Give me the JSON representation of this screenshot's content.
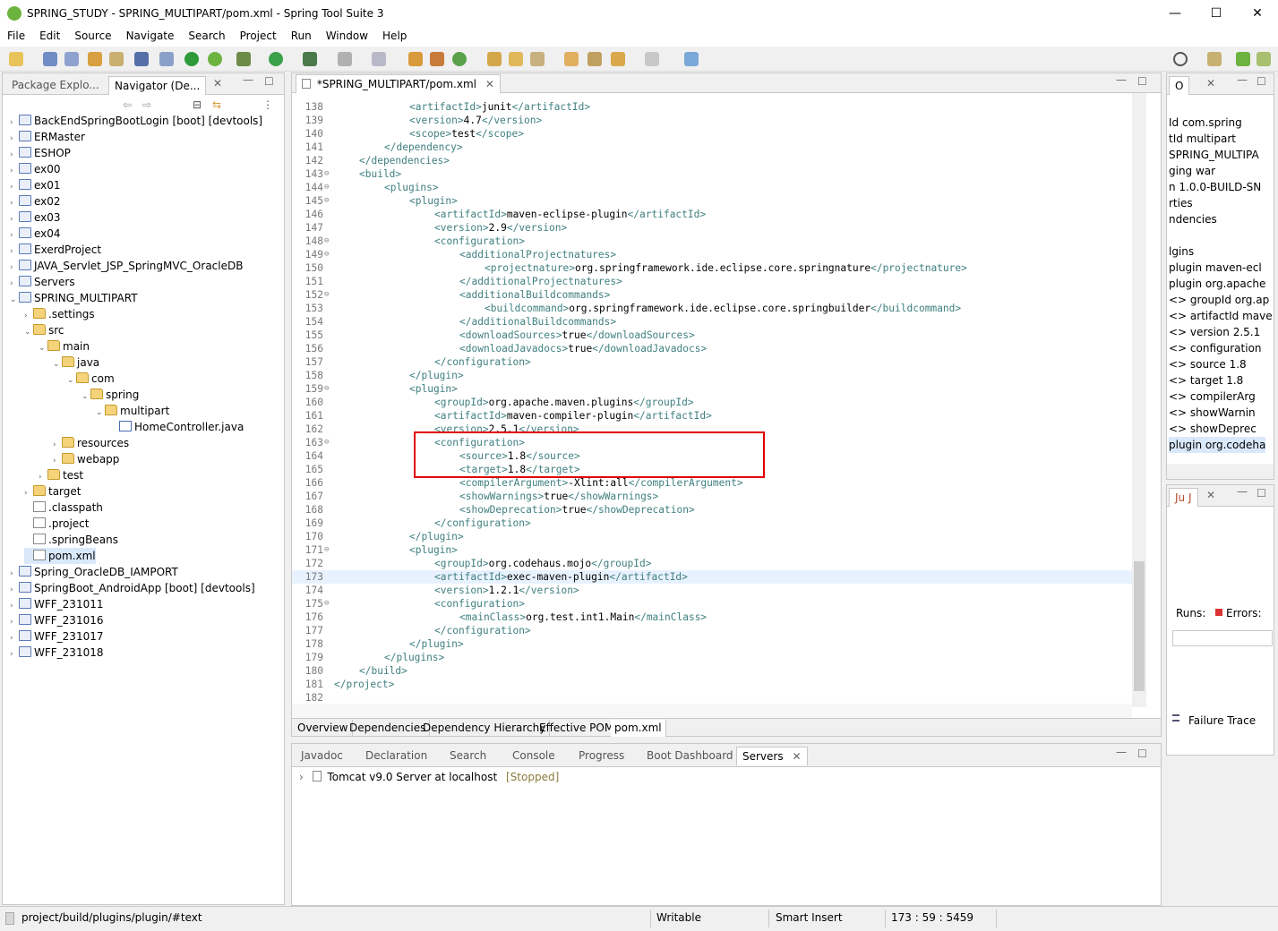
{
  "window": {
    "title": "SPRING_STUDY - SPRING_MULTIPART/pom.xml - Spring Tool Suite 3",
    "minimize": "—",
    "maximize": "☐",
    "close": "✕"
  },
  "menu": [
    "File",
    "Edit",
    "Source",
    "Navigate",
    "Search",
    "Project",
    "Run",
    "Window",
    "Help"
  ],
  "left": {
    "tabs": [
      "Package Explo...",
      "Navigator (De..."
    ],
    "tree": [
      {
        "label": "BackEndSpringBootLogin [boot] [devtools]",
        "depth": 0,
        "tw": "›",
        "icon": "proj"
      },
      {
        "label": "ERMaster",
        "depth": 0,
        "tw": "›",
        "icon": "proj"
      },
      {
        "label": "ESHOP",
        "depth": 0,
        "tw": "›",
        "icon": "proj"
      },
      {
        "label": "ex00",
        "depth": 0,
        "tw": "›",
        "icon": "proj"
      },
      {
        "label": "ex01",
        "depth": 0,
        "tw": "›",
        "icon": "proj"
      },
      {
        "label": "ex02",
        "depth": 0,
        "tw": "›",
        "icon": "proj"
      },
      {
        "label": "ex03",
        "depth": 0,
        "tw": "›",
        "icon": "proj"
      },
      {
        "label": "ex04",
        "depth": 0,
        "tw": "›",
        "icon": "proj"
      },
      {
        "label": "ExerdProject",
        "depth": 0,
        "tw": "›",
        "icon": "proj"
      },
      {
        "label": "JAVA_Servlet_JSP_SpringMVC_OracleDB",
        "depth": 0,
        "tw": "›",
        "icon": "proj"
      },
      {
        "label": "Servers",
        "depth": 0,
        "tw": "›",
        "icon": "proj"
      },
      {
        "label": "SPRING_MULTIPART",
        "depth": 0,
        "tw": "⌄",
        "icon": "proj"
      },
      {
        "label": ".settings",
        "depth": 1,
        "tw": "›",
        "icon": "folder"
      },
      {
        "label": "src",
        "depth": 1,
        "tw": "⌄",
        "icon": "folder"
      },
      {
        "label": "main",
        "depth": 2,
        "tw": "⌄",
        "icon": "folder"
      },
      {
        "label": "java",
        "depth": 3,
        "tw": "⌄",
        "icon": "folder"
      },
      {
        "label": "com",
        "depth": 4,
        "tw": "⌄",
        "icon": "folder"
      },
      {
        "label": "spring",
        "depth": 5,
        "tw": "⌄",
        "icon": "folder"
      },
      {
        "label": "multipart",
        "depth": 6,
        "tw": "⌄",
        "icon": "folder"
      },
      {
        "label": "HomeController.java",
        "depth": 7,
        "tw": "",
        "icon": "java"
      },
      {
        "label": "resources",
        "depth": 3,
        "tw": "›",
        "icon": "folder"
      },
      {
        "label": "webapp",
        "depth": 3,
        "tw": "›",
        "icon": "folder"
      },
      {
        "label": "test",
        "depth": 2,
        "tw": "›",
        "icon": "folder"
      },
      {
        "label": "target",
        "depth": 1,
        "tw": "›",
        "icon": "folder"
      },
      {
        "label": ".classpath",
        "depth": 1,
        "tw": "",
        "icon": "file"
      },
      {
        "label": ".project",
        "depth": 1,
        "tw": "",
        "icon": "file"
      },
      {
        "label": ".springBeans",
        "depth": 1,
        "tw": "",
        "icon": "file"
      },
      {
        "label": "pom.xml",
        "depth": 1,
        "tw": "",
        "icon": "file",
        "selected": true
      },
      {
        "label": "Spring_OracleDB_IAMPORT",
        "depth": 0,
        "tw": "›",
        "icon": "proj"
      },
      {
        "label": "SpringBoot_AndroidApp [boot] [devtools]",
        "depth": 0,
        "tw": "›",
        "icon": "proj"
      },
      {
        "label": "WFF_231011",
        "depth": 0,
        "tw": "›",
        "icon": "proj"
      },
      {
        "label": "WFF_231016",
        "depth": 0,
        "tw": "›",
        "icon": "proj"
      },
      {
        "label": "WFF_231017",
        "depth": 0,
        "tw": "›",
        "icon": "proj"
      },
      {
        "label": "WFF_231018",
        "depth": 0,
        "tw": "›",
        "icon": "proj"
      }
    ]
  },
  "editor": {
    "tab": "*SPRING_MULTIPART/pom.xml",
    "lines": [
      {
        "n": "138",
        "indent": 3,
        "segs": [
          [
            "t",
            "<artifactId>"
          ],
          [
            "x",
            "junit"
          ],
          [
            "t",
            "</artifactId>"
          ]
        ]
      },
      {
        "n": "139",
        "indent": 3,
        "segs": [
          [
            "t",
            "<version>"
          ],
          [
            "x",
            "4.7"
          ],
          [
            "t",
            "</version>"
          ]
        ]
      },
      {
        "n": "140",
        "indent": 3,
        "segs": [
          [
            "t",
            "<scope>"
          ],
          [
            "x",
            "test"
          ],
          [
            "t",
            "</scope>"
          ]
        ]
      },
      {
        "n": "141",
        "indent": 2,
        "segs": [
          [
            "t",
            "</dependency>"
          ]
        ]
      },
      {
        "n": "142",
        "indent": 1,
        "segs": [
          [
            "t",
            "</dependencies>"
          ]
        ]
      },
      {
        "n": "143",
        "fold": true,
        "indent": 1,
        "segs": [
          [
            "t",
            "<build>"
          ]
        ]
      },
      {
        "n": "144",
        "fold": true,
        "indent": 2,
        "segs": [
          [
            "t",
            "<plugins>"
          ]
        ]
      },
      {
        "n": "145",
        "fold": true,
        "indent": 3,
        "segs": [
          [
            "t",
            "<plugin>"
          ]
        ]
      },
      {
        "n": "146",
        "indent": 4,
        "segs": [
          [
            "t",
            "<artifactId>"
          ],
          [
            "x",
            "maven-eclipse-plugin"
          ],
          [
            "t",
            "</artifactId>"
          ]
        ]
      },
      {
        "n": "147",
        "indent": 4,
        "segs": [
          [
            "t",
            "<version>"
          ],
          [
            "x",
            "2.9"
          ],
          [
            "t",
            "</version>"
          ]
        ]
      },
      {
        "n": "148",
        "fold": true,
        "indent": 4,
        "segs": [
          [
            "t",
            "<configuration>"
          ]
        ]
      },
      {
        "n": "149",
        "fold": true,
        "indent": 5,
        "segs": [
          [
            "t",
            "<additionalProjectnatures>"
          ]
        ]
      },
      {
        "n": "150",
        "indent": 6,
        "segs": [
          [
            "t",
            "<projectnature>"
          ],
          [
            "x",
            "org.springframework.ide.eclipse.core.springnature"
          ],
          [
            "t",
            "</projectnature>"
          ]
        ]
      },
      {
        "n": "151",
        "indent": 5,
        "segs": [
          [
            "t",
            "</additionalProjectnatures>"
          ]
        ]
      },
      {
        "n": "152",
        "fold": true,
        "indent": 5,
        "segs": [
          [
            "t",
            "<additionalBuildcommands>"
          ]
        ]
      },
      {
        "n": "153",
        "indent": 6,
        "segs": [
          [
            "t",
            "<buildcommand>"
          ],
          [
            "x",
            "org.springframework.ide.eclipse.core.springbuilder"
          ],
          [
            "t",
            "</buildcommand>"
          ]
        ]
      },
      {
        "n": "154",
        "indent": 5,
        "segs": [
          [
            "t",
            "</additionalBuildcommands>"
          ]
        ]
      },
      {
        "n": "155",
        "indent": 5,
        "segs": [
          [
            "t",
            "<downloadSources>"
          ],
          [
            "x",
            "true"
          ],
          [
            "t",
            "</downloadSources>"
          ]
        ]
      },
      {
        "n": "156",
        "indent": 5,
        "segs": [
          [
            "t",
            "<downloadJavadocs>"
          ],
          [
            "x",
            "true"
          ],
          [
            "t",
            "</downloadJavadocs>"
          ]
        ]
      },
      {
        "n": "157",
        "indent": 4,
        "segs": [
          [
            "t",
            "</configuration>"
          ]
        ]
      },
      {
        "n": "158",
        "indent": 3,
        "segs": [
          [
            "t",
            "</plugin>"
          ]
        ]
      },
      {
        "n": "159",
        "fold": true,
        "indent": 3,
        "segs": [
          [
            "t",
            "<plugin>"
          ]
        ]
      },
      {
        "n": "160",
        "indent": 4,
        "segs": [
          [
            "t",
            "<groupId>"
          ],
          [
            "x",
            "org.apache.maven.plugins"
          ],
          [
            "t",
            "</groupId>"
          ]
        ]
      },
      {
        "n": "161",
        "indent": 4,
        "segs": [
          [
            "t",
            "<artifactId>"
          ],
          [
            "x",
            "maven-compiler-plugin"
          ],
          [
            "t",
            "</artifactId>"
          ]
        ]
      },
      {
        "n": "162",
        "indent": 4,
        "segs": [
          [
            "t",
            "<version>"
          ],
          [
            "x",
            "2.5.1"
          ],
          [
            "t",
            "</version>"
          ]
        ]
      },
      {
        "n": "163",
        "fold": true,
        "indent": 4,
        "segs": [
          [
            "t",
            "<configuration>"
          ]
        ]
      },
      {
        "n": "164",
        "indent": 5,
        "segs": [
          [
            "t",
            "<source>"
          ],
          [
            "x",
            "1.8"
          ],
          [
            "t",
            "</source>"
          ]
        ]
      },
      {
        "n": "165",
        "indent": 5,
        "segs": [
          [
            "t",
            "<target>"
          ],
          [
            "x",
            "1.8"
          ],
          [
            "t",
            "</target>"
          ]
        ]
      },
      {
        "n": "166",
        "indent": 5,
        "segs": [
          [
            "t",
            "<compilerArgument>"
          ],
          [
            "x",
            "-Xlint:all"
          ],
          [
            "t",
            "</compilerArgument>"
          ]
        ]
      },
      {
        "n": "167",
        "indent": 5,
        "segs": [
          [
            "t",
            "<showWarnings>"
          ],
          [
            "x",
            "true"
          ],
          [
            "t",
            "</showWarnings>"
          ]
        ]
      },
      {
        "n": "168",
        "indent": 5,
        "segs": [
          [
            "t",
            "<showDeprecation>"
          ],
          [
            "x",
            "true"
          ],
          [
            "t",
            "</showDeprecation>"
          ]
        ]
      },
      {
        "n": "169",
        "indent": 4,
        "segs": [
          [
            "t",
            "</configuration>"
          ]
        ]
      },
      {
        "n": "170",
        "indent": 3,
        "segs": [
          [
            "t",
            "</plugin>"
          ]
        ]
      },
      {
        "n": "171",
        "fold": true,
        "indent": 3,
        "segs": [
          [
            "t",
            "<plugin>"
          ]
        ]
      },
      {
        "n": "172",
        "indent": 4,
        "segs": [
          [
            "t",
            "<groupId>"
          ],
          [
            "x",
            "org.codehaus.mojo"
          ],
          [
            "t",
            "</groupId>"
          ]
        ]
      },
      {
        "n": "173",
        "indent": 4,
        "current": true,
        "segs": [
          [
            "t",
            "<artifactId>"
          ],
          [
            "x",
            "exec-maven-plugin"
          ],
          [
            "t",
            "</artifactId>"
          ]
        ]
      },
      {
        "n": "174",
        "indent": 4,
        "segs": [
          [
            "t",
            "<version>"
          ],
          [
            "x",
            "1.2.1"
          ],
          [
            "t",
            "</version>"
          ]
        ]
      },
      {
        "n": "175",
        "fold": true,
        "indent": 4,
        "segs": [
          [
            "t",
            "<configuration>"
          ]
        ]
      },
      {
        "n": "176",
        "indent": 5,
        "segs": [
          [
            "t",
            "<mainClass>"
          ],
          [
            "x",
            "org.test.int1.Main"
          ],
          [
            "t",
            "</mainClass>"
          ]
        ]
      },
      {
        "n": "177",
        "indent": 4,
        "segs": [
          [
            "t",
            "</configuration>"
          ]
        ]
      },
      {
        "n": "178",
        "indent": 3,
        "segs": [
          [
            "t",
            "</plugin>"
          ]
        ]
      },
      {
        "n": "179",
        "indent": 2,
        "segs": [
          [
            "t",
            "</plugins>"
          ]
        ]
      },
      {
        "n": "180",
        "indent": 1,
        "segs": [
          [
            "t",
            "</build>"
          ]
        ]
      },
      {
        "n": "181",
        "indent": 0,
        "segs": [
          [
            "t",
            "</project>"
          ]
        ]
      },
      {
        "n": "182",
        "indent": 0,
        "segs": []
      }
    ],
    "bottom_tabs": [
      "Overview",
      "Dependencies",
      "Dependency Hierarchy",
      "Effective POM",
      "pom.xml"
    ]
  },
  "bottom": {
    "tabs": [
      "Javadoc",
      "Declaration",
      "Search",
      "Console",
      "Progress",
      "Boot Dashboard",
      "Servers"
    ],
    "server": "Tomcat v9.0 Server at localhost",
    "server_state": "[Stopped]"
  },
  "outline": {
    "tab": "O",
    "rows": [
      "Id  com.spring",
      "tId  multipart",
      "  SPRING_MULTIPA",
      "ging  war",
      "n  1.0.0-BUILD-SN",
      "rties",
      "ndencies",
      "",
      "lgins",
      "plugin  maven-ecl",
      "plugin  org.apache",
      "<> groupId  org.ap",
      "<> artifactId  mave",
      "<> version  2.5.1",
      "<> configuration",
      "   <> source  1.8",
      "   <> target  1.8",
      "   <> compilerArg",
      "   <> showWarnin",
      "   <> showDeprec",
      "plugin  org.codeha"
    ]
  },
  "junit": {
    "tab": "Ju J",
    "runs": "Runs:",
    "errors": "Errors:",
    "failure_trace": "Failure Trace"
  },
  "status": {
    "path": "project/build/plugins/plugin/#text",
    "writable": "Writable",
    "insert": "Smart Insert",
    "position": "173 : 59 : 5459"
  },
  "colors": {
    "tag": "#3f7f7f",
    "highlight_box": "#e00000",
    "current_line": "#e8f2fe"
  }
}
